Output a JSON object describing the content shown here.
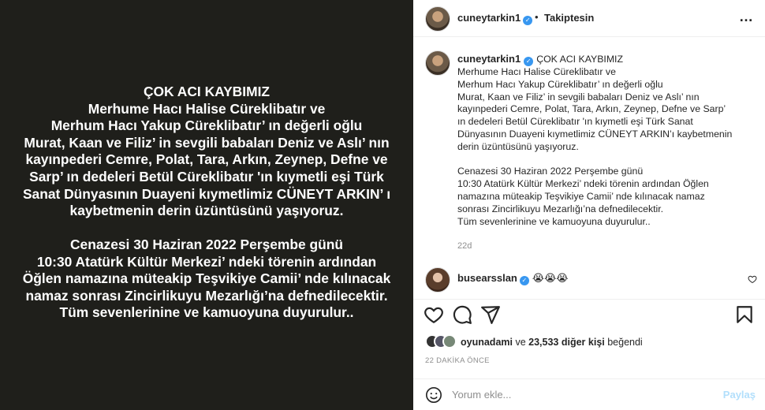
{
  "image_text": {
    "block1": [
      "ÇOK ACI KAYBIMIZ",
      "Merhume Hacı Halise Cüreklibatır ve",
      "Merhum Hacı Yakup Cüreklibatır’ ın değerli oğlu",
      "Murat, Kaan ve Filiz’ in sevgili babaları Deniz ve Aslı’ nın",
      "kayınpederi Cemre, Polat, Tara, Arkın, Zeynep, Defne ve",
      "Sarp’ ın dedeleri Betül Cüreklibatır 'ın kıymetli eşi Türk",
      "Sanat Dünyasının Duayeni kıymetlimiz CÜNEYT ARKIN’ ı",
      "kaybetmenin derin üzüntüsünü yaşıyoruz."
    ],
    "block2": [
      "Cenazesi 30 Haziran 2022 Perşembe günü",
      "10:30 Atatürk Kültür Merkezi’ ndeki törenin ardından",
      "Öğlen namazına müteakip Teşvikiye Camii’ nde kılınacak",
      "namaz sonrası Zincirlikuyu Mezarlığı’na defnedilecektir.",
      "Tüm sevenlerinine ve kamuoyuna duyurulur.."
    ]
  },
  "header": {
    "username": "cuneytarkin1",
    "dot": "•",
    "follow_label": "Takiptesin",
    "more_icon": "…"
  },
  "caption": {
    "username": "cuneytarkin1",
    "first": "ÇOK ACI KAYBIMIZ",
    "lines1": [
      "Merhume Hacı Halise Cüreklibatır ve",
      "Merhum Hacı Yakup Cüreklibatır’ ın değerli oğlu",
      "Murat, Kaan ve Filiz’ in sevgili babaları Deniz ve Aslı’ nın",
      "kayınpederi Cemre, Polat, Tara, Arkın, Zeynep, Defne ve Sarp’",
      "ın dedeleri Betül Cüreklibatır 'ın kıymetli eşi Türk Sanat",
      "Dünyasının Duayeni kıymetlimiz CÜNEYT ARKIN’ı kaybetmenin",
      "derin üzüntüsünü yaşıyoruz."
    ],
    "lines2": [
      "Cenazesi 30 Haziran 2022 Perşembe günü",
      "10:30 Atatürk Kültür Merkezi’ ndeki törenin ardından Öğlen",
      "namazına müteakip Teşvikiye Camii’ nde kılınacak namaz",
      "sonrası Zincirlikuyu Mezarlığı’na defnedilecektir.",
      "Tüm sevenlerinine ve kamuoyuna duyurulur.."
    ],
    "time": "22d"
  },
  "comment": {
    "username": "busearsslan",
    "text": "😭😭😭"
  },
  "likes": {
    "user": "oyunadami",
    "middle": " ve ",
    "count": "23,533 diğer kişi",
    "suffix": " beğendi"
  },
  "post_time": "22 DAKİKA ÖNCE",
  "add_comment": {
    "placeholder": "Yorum ekle...",
    "post_label": "Paylaş"
  },
  "colors": {
    "image_bg": "#1f1f1b",
    "verified": "#3897f0",
    "post_button_disabled": "#b2dffc",
    "muted": "#8e8e8e"
  },
  "icons": [
    "verified-icon",
    "more-icon",
    "heart-icon",
    "comment-icon",
    "share-icon",
    "bookmark-icon",
    "emoji-icon"
  ]
}
